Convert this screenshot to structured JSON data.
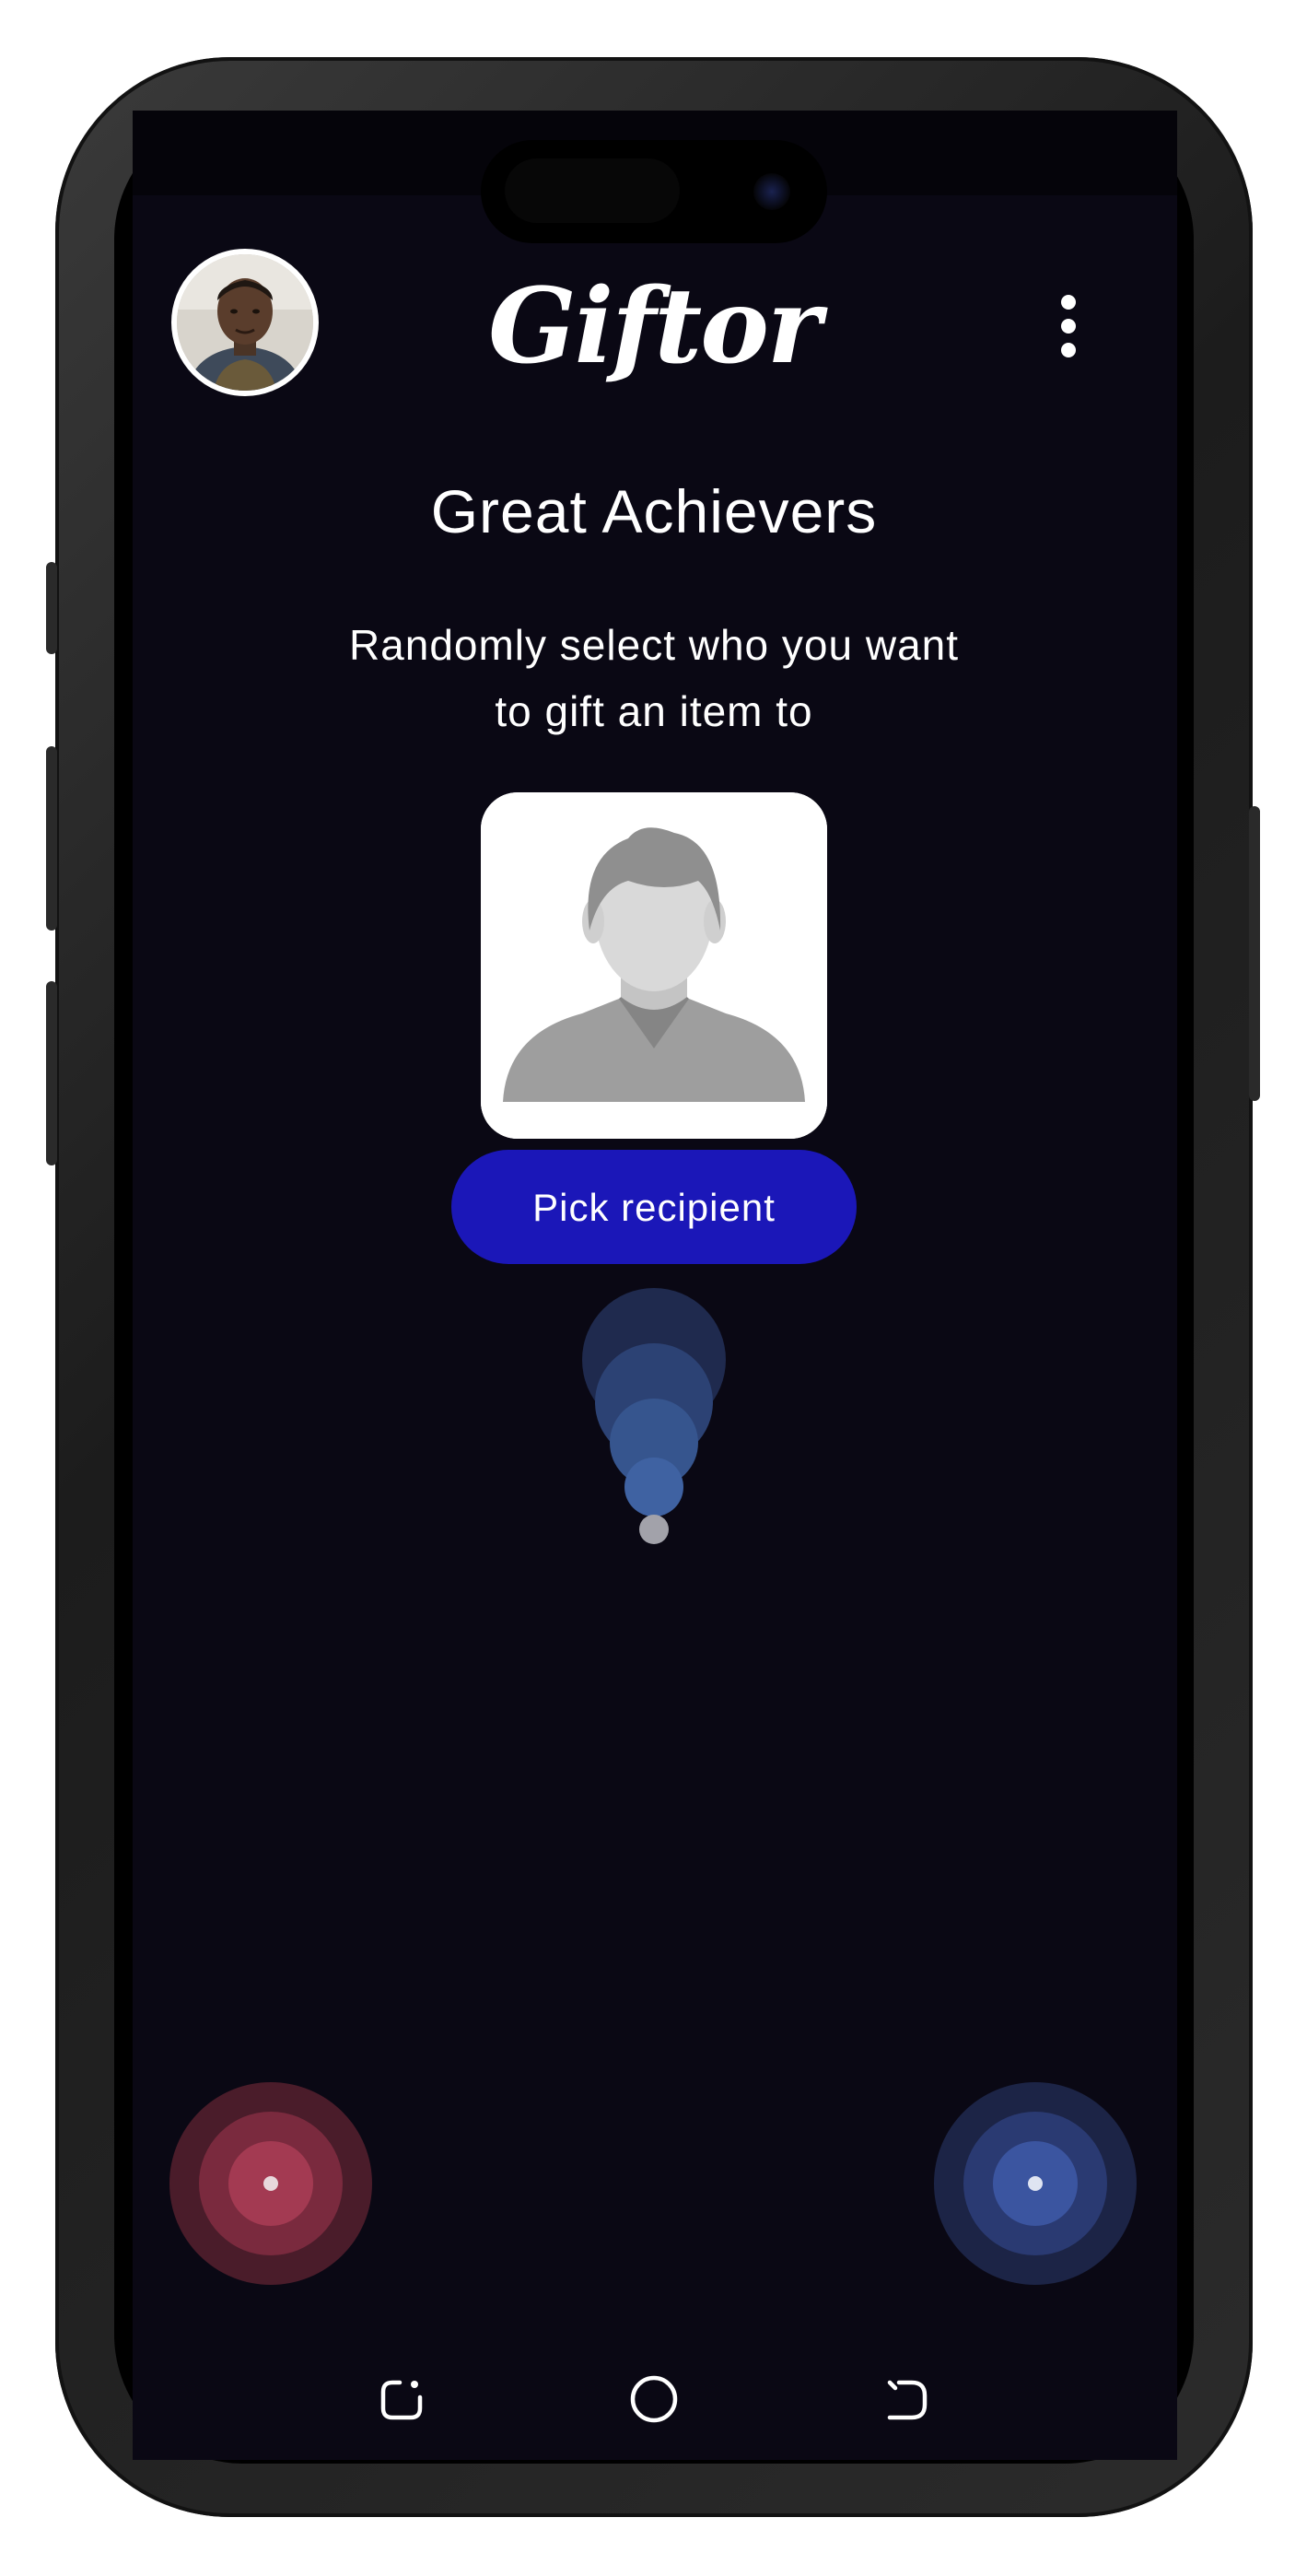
{
  "app": {
    "logo_text": "Giftor",
    "colors": {
      "background": "#0a0814",
      "accent": "#1b17b8",
      "text": "#ffffff",
      "ripple_blue": "#3f5fa8",
      "ripple_red": "#b0445c"
    }
  },
  "header": {
    "avatar_icon": "user-avatar",
    "menu_icon": "more-vertical-icon"
  },
  "main": {
    "title": "Great Achievers",
    "subtitle_line1": "Randomly select who you want",
    "subtitle_line2": "to gift an item to",
    "placeholder_icon": "person-silhouette-icon",
    "pick_button_label": "Pick recipient"
  },
  "bottom_nav": {
    "recents_icon": "recent-apps-icon",
    "home_icon": "home-circle-icon",
    "back_icon": "back-icon"
  }
}
